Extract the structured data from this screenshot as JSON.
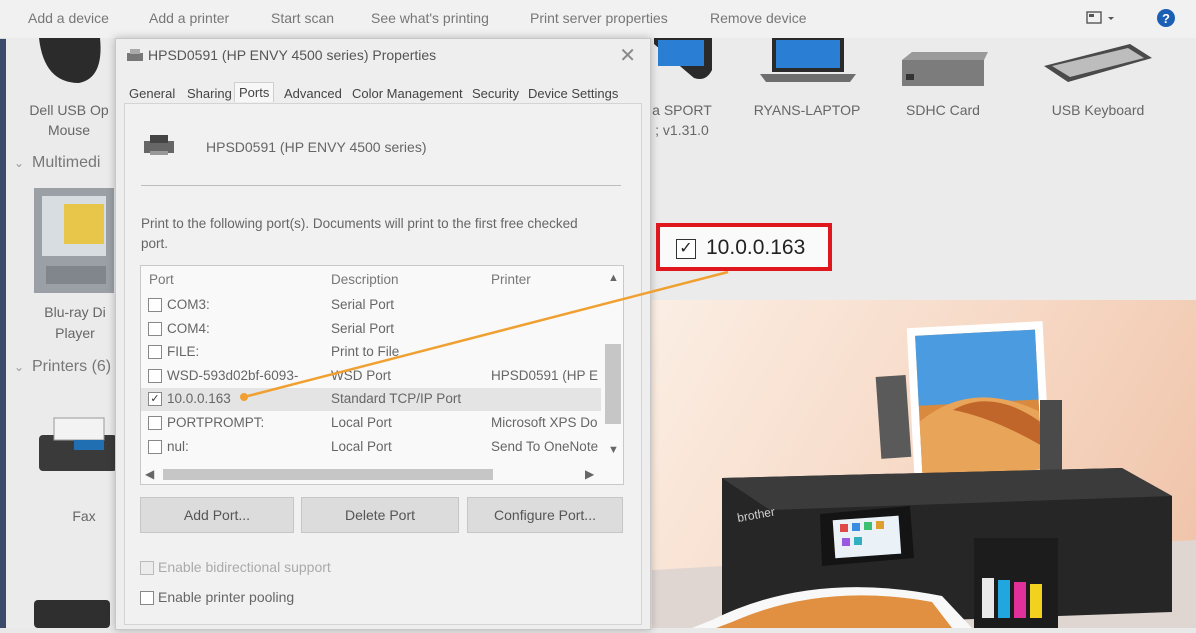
{
  "toolbar": {
    "items": [
      "Add a device",
      "Add a printer",
      "Start scan",
      "See what's printing",
      "Print server properties",
      "Remove device"
    ]
  },
  "devices": {
    "top_left": {
      "line1": "Dell USB Op",
      "line2": "Mouse"
    },
    "categories": {
      "multimedia": "Multimedi",
      "printers": "Printers (6)"
    },
    "multimedia_item": {
      "line1": "Blu-ray Di",
      "line2": "Player"
    },
    "fax": "Fax",
    "top_items": [
      {
        "line1": "a SPORT",
        "line2": "; v1.31.0"
      },
      {
        "line1": "RYANS-LAPTOP",
        "line2": ""
      },
      {
        "line1": "SDHC Card",
        "line2": ""
      },
      {
        "line1": "USB Keyboard",
        "line2": ""
      }
    ]
  },
  "dialog": {
    "title": "HPSD0591 (HP ENVY 4500 series) Properties",
    "tabs": [
      "General",
      "Sharing",
      "Ports",
      "Advanced",
      "Color Management",
      "Security",
      "Device Settings"
    ],
    "active_tab": "Ports",
    "printer_name": "HPSD0591 (HP ENVY 4500 series)",
    "info_text": "Print to the following port(s). Documents will print to the first free checked port.",
    "columns": [
      "Port",
      "Description",
      "Printer"
    ],
    "ports": [
      {
        "port": "COM3:",
        "description": "Serial Port",
        "printer": "",
        "checked": false,
        "highlight": false
      },
      {
        "port": "COM4:",
        "description": "Serial Port",
        "printer": "",
        "checked": false,
        "highlight": false
      },
      {
        "port": "FILE:",
        "description": "Print to File",
        "printer": "",
        "checked": false,
        "highlight": false
      },
      {
        "port": "WSD-593d02bf-6093-",
        "description": "WSD Port",
        "printer": "HPSD0591 (HP E",
        "checked": false,
        "highlight": false
      },
      {
        "port": "10.0.0.163",
        "description": "Standard TCP/IP Port",
        "printer": "",
        "checked": true,
        "highlight": true
      },
      {
        "port": "PORTPROMPT:",
        "description": "Local Port",
        "printer": "Microsoft XPS Do",
        "checked": false,
        "highlight": false
      },
      {
        "port": "nul:",
        "description": "Local Port",
        "printer": "Send To OneNote",
        "checked": false,
        "highlight": false
      }
    ],
    "buttons": {
      "add": "Add Port...",
      "delete": "Delete Port",
      "configure": "Configure Port..."
    },
    "bidirectional": {
      "label": "Enable bidirectional support",
      "checked": false,
      "disabled": true
    },
    "pooling": {
      "label": "Enable printer pooling",
      "checked": false
    }
  },
  "callout": {
    "text": "10.0.0.163",
    "checked": true
  },
  "photo": {
    "brand": "brother"
  },
  "colors": {
    "callout_border": "#e0161d",
    "connector": "#f0a030",
    "help_icon": "#1a5fb4"
  }
}
